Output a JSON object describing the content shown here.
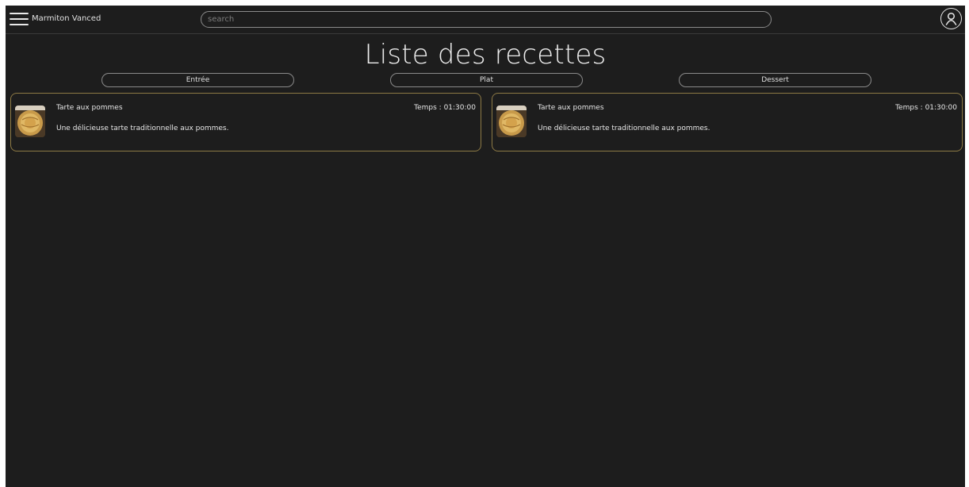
{
  "header": {
    "app_title": "Marmiton Vanced",
    "search_placeholder": "search",
    "menu_icon": "hamburger-icon",
    "profile_icon": "user-icon"
  },
  "page": {
    "title": "Liste des recettes"
  },
  "filters": [
    {
      "label": "Entrée"
    },
    {
      "label": "Plat"
    },
    {
      "label": "Dessert"
    }
  ],
  "recipes": [
    {
      "name": "Tarte aux pommes",
      "time_label": "Temps : 01:30:00",
      "description": "Une délicieuse tarte traditionnelle aux pommes."
    },
    {
      "name": "Tarte aux pommes",
      "time_label": "Temps : 01:30:00",
      "description": "Une délicieuse tarte traditionnelle aux pommes."
    }
  ],
  "colors": {
    "background": "#1d1d1d",
    "card_border": "#8d7a45",
    "text": "#e6e6e6",
    "outline": "#8a8a8a"
  }
}
